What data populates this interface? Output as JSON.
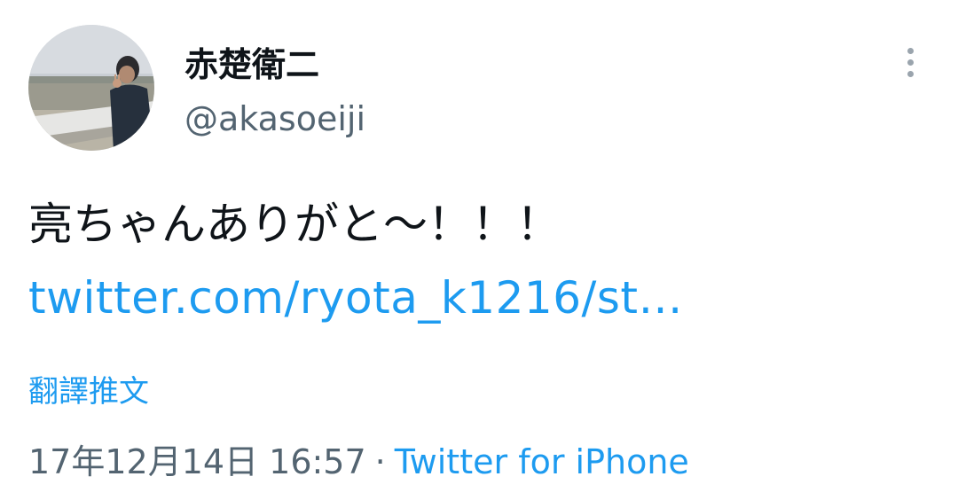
{
  "author": {
    "display_name": "赤楚衛二",
    "handle": "@akasoeiji",
    "avatar_icon": "user-avatar-photo"
  },
  "tweet": {
    "text": "亮ちゃんありがと〜！！！",
    "link_text": "twitter.com/ryota_k1216/st…",
    "translate_label": "翻譯推文",
    "timestamp": "17年12月14日 16:57",
    "separator": "·",
    "source": "Twitter for iPhone"
  },
  "menu": {
    "icon": "more-vertical-icon"
  },
  "colors": {
    "link": "#1d9bf0",
    "secondary_text": "#536471",
    "primary_text": "#0f1419",
    "background": "#ffffff"
  }
}
